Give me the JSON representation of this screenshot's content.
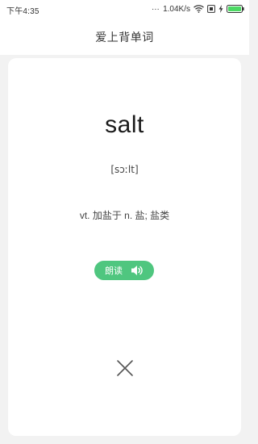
{
  "status_bar": {
    "time": "下午4:35",
    "dots": "...",
    "network_speed": "1.04K/s"
  },
  "header": {
    "title": "爱上背单词"
  },
  "card": {
    "word": "salt",
    "phonetic": "[sɔːlt]",
    "definition": "vt. 加盐于 n. 盐; 盐类",
    "read_button_label": "朗读"
  },
  "colors": {
    "accent_green": "#4fc67f",
    "background": "#f2f2f2",
    "card": "#ffffff"
  }
}
